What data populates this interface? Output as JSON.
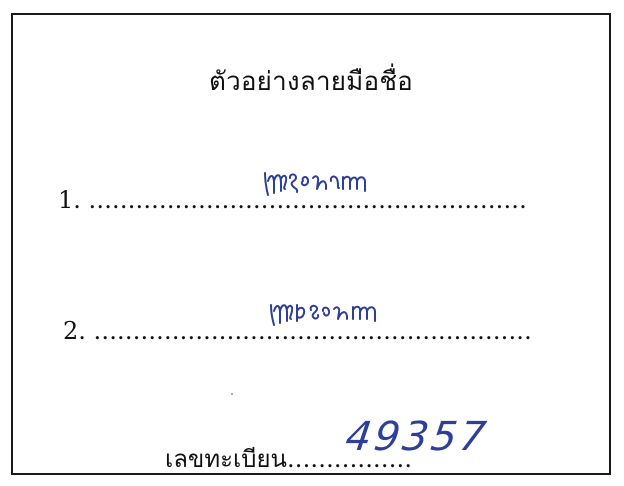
{
  "form": {
    "title": "ตัวอย่างลายมือชื่อ",
    "signature_lines": [
      {
        "number": "1.",
        "dots": "........................................................"
      },
      {
        "number": "2.",
        "dots": "........................................................"
      }
    ],
    "registration": {
      "label": "เลขทะเบียน",
      "dots": "................",
      "value": "49357"
    }
  },
  "colors": {
    "ink": "#2d3f9a",
    "border": "#1a1a1a"
  }
}
